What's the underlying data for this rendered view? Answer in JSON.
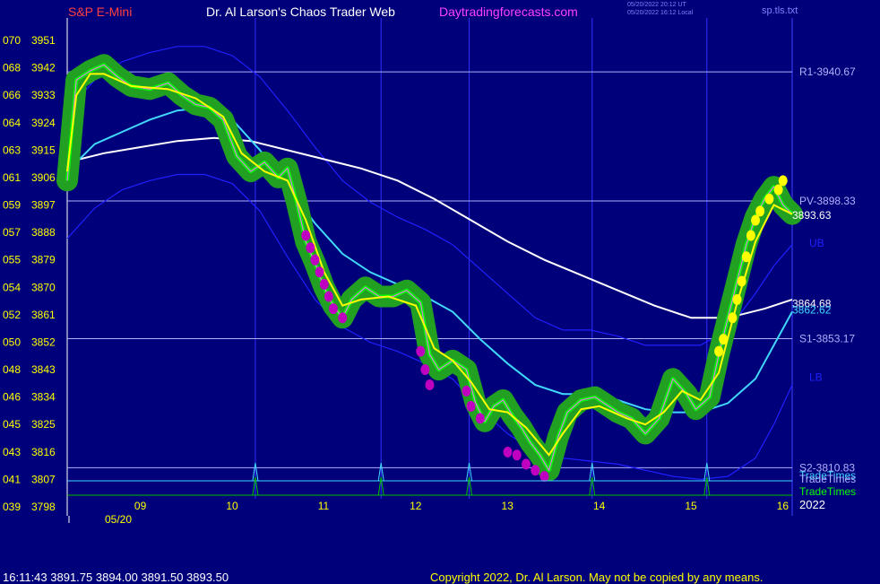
{
  "header": {
    "instrument": "S&P E-Mini",
    "site": "Dr. Al Larson's Chaos Trader Web",
    "url": "Daytradingforecasts.com",
    "update_line1": "05/20/2022 20:12 UT",
    "update_line2": "05/20/2022 16:12 Local",
    "file": "sp.tls.txt"
  },
  "footer": {
    "quote": "16:11:43  3891.75 3894.00 3891.50 3893.50",
    "copyright": "Copyright 2022, Dr. Al Larson. May not be copied by any means."
  },
  "colors": {
    "background": "#00007a",
    "price": "#00ff00",
    "halo": "#22a022",
    "short_ma": "#ffff00",
    "mid_ma": "#40d8ff",
    "long_ma": "#ffffff",
    "band": "#2020ff",
    "levels": "#b0b0ff",
    "bullish_dots": "#ffff00",
    "bearish_dots": "#c000c0",
    "markers": "#40d8ff"
  },
  "chart_data": {
    "type": "line",
    "title": "S&P E-Mini",
    "date": "05/20",
    "year": "2022",
    "y_axis": {
      "ticks": [
        {
          "code": "070",
          "price": 3951
        },
        {
          "code": "068",
          "price": 3942
        },
        {
          "code": "066",
          "price": 3933
        },
        {
          "code": "064",
          "price": 3924
        },
        {
          "code": "063",
          "price": 3915
        },
        {
          "code": "061",
          "price": 3906
        },
        {
          "code": "059",
          "price": 3897
        },
        {
          "code": "057",
          "price": 3888
        },
        {
          "code": "055",
          "price": 3879
        },
        {
          "code": "054",
          "price": 3870
        },
        {
          "code": "052",
          "price": 3861
        },
        {
          "code": "050",
          "price": 3852
        },
        {
          "code": "048",
          "price": 3843
        },
        {
          "code": "046",
          "price": 3834
        },
        {
          "code": "045",
          "price": 3825
        },
        {
          "code": "043",
          "price": 3816
        },
        {
          "code": "041",
          "price": 3807
        },
        {
          "code": "039",
          "price": 3798
        }
      ],
      "ylim": [
        3798,
        3955
      ]
    },
    "x_axis": {
      "hours": [
        "09",
        "10",
        "11",
        "12",
        "13",
        "14",
        "15",
        "16"
      ],
      "xlim": [
        8.2,
        16.1
      ]
    },
    "levels": [
      {
        "label": "R1-3940.67",
        "value": 3940.67
      },
      {
        "label": "PV-3898.33",
        "value": 3898.33
      },
      {
        "label": "S1-3853.17",
        "value": 3853.17
      },
      {
        "label": "S2-3810.83",
        "value": 3810.83
      }
    ],
    "right_labels": [
      {
        "label": "3893.63",
        "value": 3893.63,
        "color": "#ffffff"
      },
      {
        "label": "3864.68",
        "value": 3864.68,
        "color": "#ffffff"
      },
      {
        "label": "3862.62",
        "value": 3862.62,
        "color": "#40d8ff"
      },
      {
        "label": "UB",
        "value": 3884.5,
        "color": "#2020ff"
      },
      {
        "label": "LB",
        "value": 3840.5,
        "color": "#2020ff"
      }
    ],
    "marker_labels": [
      "TradeTimes",
      "TradeTimes"
    ],
    "trade_times_label": "TradeTimes",
    "vertical_lines": [
      10.25,
      11.62,
      12.58,
      13.92,
      15.17
    ],
    "series": [
      {
        "name": "price",
        "points": [
          [
            8.2,
            3905
          ],
          [
            8.3,
            3938
          ],
          [
            8.45,
            3941
          ],
          [
            8.6,
            3943
          ],
          [
            8.75,
            3939
          ],
          [
            8.9,
            3936
          ],
          [
            9.1,
            3935
          ],
          [
            9.3,
            3937
          ],
          [
            9.45,
            3933
          ],
          [
            9.6,
            3930
          ],
          [
            9.75,
            3929
          ],
          [
            9.9,
            3925
          ],
          [
            10.05,
            3913
          ],
          [
            10.2,
            3908
          ],
          [
            10.35,
            3911
          ],
          [
            10.5,
            3906
          ],
          [
            10.6,
            3909
          ],
          [
            10.7,
            3898
          ],
          [
            10.8,
            3885
          ],
          [
            10.9,
            3878
          ],
          [
            11.0,
            3870
          ],
          [
            11.1,
            3864
          ],
          [
            11.2,
            3860
          ],
          [
            11.3,
            3866
          ],
          [
            11.45,
            3870
          ],
          [
            11.6,
            3867
          ],
          [
            11.75,
            3867
          ],
          [
            11.9,
            3869
          ],
          [
            12.05,
            3865
          ],
          [
            12.15,
            3848
          ],
          [
            12.25,
            3843
          ],
          [
            12.4,
            3846
          ],
          [
            12.55,
            3843
          ],
          [
            12.65,
            3832
          ],
          [
            12.75,
            3826
          ],
          [
            12.85,
            3831
          ],
          [
            12.95,
            3833
          ],
          [
            13.05,
            3828
          ],
          [
            13.15,
            3824
          ],
          [
            13.25,
            3819
          ],
          [
            13.35,
            3815
          ],
          [
            13.45,
            3810
          ],
          [
            13.55,
            3821
          ],
          [
            13.65,
            3829
          ],
          [
            13.8,
            3833
          ],
          [
            13.95,
            3834
          ],
          [
            14.05,
            3832
          ],
          [
            14.2,
            3829
          ],
          [
            14.35,
            3827
          ],
          [
            14.5,
            3822
          ],
          [
            14.65,
            3827
          ],
          [
            14.8,
            3840
          ],
          [
            14.95,
            3835
          ],
          [
            15.05,
            3830
          ],
          [
            15.2,
            3834
          ],
          [
            15.3,
            3848
          ],
          [
            15.4,
            3860
          ],
          [
            15.5,
            3872
          ],
          [
            15.6,
            3884
          ],
          [
            15.7,
            3893
          ],
          [
            15.8,
            3899
          ],
          [
            15.9,
            3903
          ],
          [
            16.0,
            3897
          ],
          [
            16.1,
            3894
          ]
        ]
      },
      {
        "name": "short-ma",
        "points": [
          [
            8.2,
            3908
          ],
          [
            8.3,
            3933
          ],
          [
            8.45,
            3940
          ],
          [
            8.6,
            3940
          ],
          [
            8.9,
            3936
          ],
          [
            9.3,
            3935
          ],
          [
            9.6,
            3932
          ],
          [
            9.9,
            3926
          ],
          [
            10.1,
            3914
          ],
          [
            10.35,
            3908
          ],
          [
            10.6,
            3905
          ],
          [
            10.8,
            3892
          ],
          [
            11.0,
            3875
          ],
          [
            11.2,
            3864
          ],
          [
            11.4,
            3866
          ],
          [
            11.7,
            3867
          ],
          [
            12.0,
            3864
          ],
          [
            12.2,
            3850
          ],
          [
            12.4,
            3846
          ],
          [
            12.6,
            3839
          ],
          [
            12.8,
            3830
          ],
          [
            13.0,
            3829
          ],
          [
            13.2,
            3824
          ],
          [
            13.45,
            3815
          ],
          [
            13.6,
            3822
          ],
          [
            13.8,
            3830
          ],
          [
            14.0,
            3831
          ],
          [
            14.3,
            3827
          ],
          [
            14.5,
            3825
          ],
          [
            14.7,
            3829
          ],
          [
            14.9,
            3836
          ],
          [
            15.1,
            3833
          ],
          [
            15.3,
            3842
          ],
          [
            15.5,
            3865
          ],
          [
            15.7,
            3885
          ],
          [
            15.9,
            3897
          ],
          [
            16.1,
            3894
          ]
        ]
      },
      {
        "name": "mid-ma",
        "points": [
          [
            8.2,
            3908
          ],
          [
            8.5,
            3917
          ],
          [
            8.8,
            3921
          ],
          [
            9.1,
            3925
          ],
          [
            9.4,
            3928
          ],
          [
            9.7,
            3929
          ],
          [
            10.0,
            3925
          ],
          [
            10.3,
            3915
          ],
          [
            10.6,
            3903
          ],
          [
            10.9,
            3891
          ],
          [
            11.2,
            3881
          ],
          [
            11.5,
            3875
          ],
          [
            11.8,
            3871
          ],
          [
            12.1,
            3867
          ],
          [
            12.4,
            3862
          ],
          [
            12.7,
            3853
          ],
          [
            13.0,
            3845
          ],
          [
            13.3,
            3838
          ],
          [
            13.6,
            3835
          ],
          [
            13.9,
            3835
          ],
          [
            14.2,
            3833
          ],
          [
            14.5,
            3830
          ],
          [
            14.8,
            3829
          ],
          [
            15.1,
            3829
          ],
          [
            15.4,
            3832
          ],
          [
            15.7,
            3840
          ],
          [
            15.9,
            3851
          ],
          [
            16.1,
            3862
          ]
        ]
      },
      {
        "name": "long-ma",
        "points": [
          [
            8.2,
            3911
          ],
          [
            8.6,
            3914
          ],
          [
            9.0,
            3916
          ],
          [
            9.4,
            3918
          ],
          [
            9.8,
            3919
          ],
          [
            10.2,
            3918
          ],
          [
            10.6,
            3915
          ],
          [
            11.0,
            3912
          ],
          [
            11.4,
            3909
          ],
          [
            11.8,
            3905
          ],
          [
            12.2,
            3899
          ],
          [
            12.6,
            3892
          ],
          [
            13.0,
            3885
          ],
          [
            13.4,
            3879
          ],
          [
            13.8,
            3874
          ],
          [
            14.2,
            3869
          ],
          [
            14.6,
            3864
          ],
          [
            15.0,
            3860
          ],
          [
            15.4,
            3860
          ],
          [
            15.8,
            3863
          ],
          [
            16.1,
            3866
          ]
        ]
      },
      {
        "name": "upper-band",
        "points": [
          [
            8.2,
            3928
          ],
          [
            8.5,
            3938
          ],
          [
            8.8,
            3944
          ],
          [
            9.1,
            3947
          ],
          [
            9.4,
            3949
          ],
          [
            9.7,
            3949
          ],
          [
            10.0,
            3946
          ],
          [
            10.3,
            3939
          ],
          [
            10.6,
            3928
          ],
          [
            10.9,
            3916
          ],
          [
            11.2,
            3905
          ],
          [
            11.5,
            3898
          ],
          [
            11.8,
            3893
          ],
          [
            12.1,
            3889
          ],
          [
            12.4,
            3884
          ],
          [
            12.7,
            3876
          ],
          [
            13.0,
            3868
          ],
          [
            13.3,
            3860
          ],
          [
            13.6,
            3856
          ],
          [
            13.9,
            3856
          ],
          [
            14.2,
            3854
          ],
          [
            14.5,
            3851
          ],
          [
            14.8,
            3851
          ],
          [
            15.1,
            3851
          ],
          [
            15.4,
            3856
          ],
          [
            15.7,
            3868
          ],
          [
            15.9,
            3877
          ],
          [
            16.1,
            3884
          ]
        ]
      },
      {
        "name": "lower-band",
        "points": [
          [
            8.2,
            3886
          ],
          [
            8.5,
            3896
          ],
          [
            8.8,
            3902
          ],
          [
            9.1,
            3905
          ],
          [
            9.4,
            3907
          ],
          [
            9.7,
            3907
          ],
          [
            10.0,
            3904
          ],
          [
            10.3,
            3895
          ],
          [
            10.6,
            3880
          ],
          [
            10.9,
            3866
          ],
          [
            11.2,
            3857
          ],
          [
            11.5,
            3852
          ],
          [
            11.8,
            3849
          ],
          [
            12.1,
            3845
          ],
          [
            12.4,
            3840
          ],
          [
            12.7,
            3830
          ],
          [
            13.0,
            3822
          ],
          [
            13.3,
            3816
          ],
          [
            13.6,
            3814
          ],
          [
            13.9,
            3813
          ],
          [
            14.2,
            3812
          ],
          [
            14.5,
            3810
          ],
          [
            14.8,
            3808
          ],
          [
            15.1,
            3807
          ],
          [
            15.4,
            3808
          ],
          [
            15.7,
            3814
          ],
          [
            15.9,
            3825
          ],
          [
            16.1,
            3838
          ]
        ]
      }
    ],
    "bullish_dots": [
      [
        15.3,
        3849
      ],
      [
        15.35,
        3853
      ],
      [
        15.45,
        3860
      ],
      [
        15.5,
        3866
      ],
      [
        15.55,
        3872
      ],
      [
        15.6,
        3880
      ],
      [
        15.65,
        3887
      ],
      [
        15.7,
        3892
      ],
      [
        15.75,
        3895
      ],
      [
        15.85,
        3899
      ],
      [
        15.95,
        3902
      ],
      [
        16.0,
        3905
      ]
    ],
    "bearish_dots": [
      [
        10.8,
        3887
      ],
      [
        10.85,
        3883
      ],
      [
        10.9,
        3879
      ],
      [
        10.95,
        3875
      ],
      [
        11.0,
        3871
      ],
      [
        11.05,
        3867
      ],
      [
        11.1,
        3863
      ],
      [
        11.2,
        3860
      ],
      [
        12.05,
        3849
      ],
      [
        12.1,
        3843
      ],
      [
        12.15,
        3838
      ],
      [
        12.55,
        3836
      ],
      [
        12.6,
        3831
      ],
      [
        12.7,
        3827
      ],
      [
        13.0,
        3816
      ],
      [
        13.1,
        3815
      ],
      [
        13.2,
        3812
      ],
      [
        13.3,
        3810
      ],
      [
        13.4,
        3808
      ]
    ]
  }
}
